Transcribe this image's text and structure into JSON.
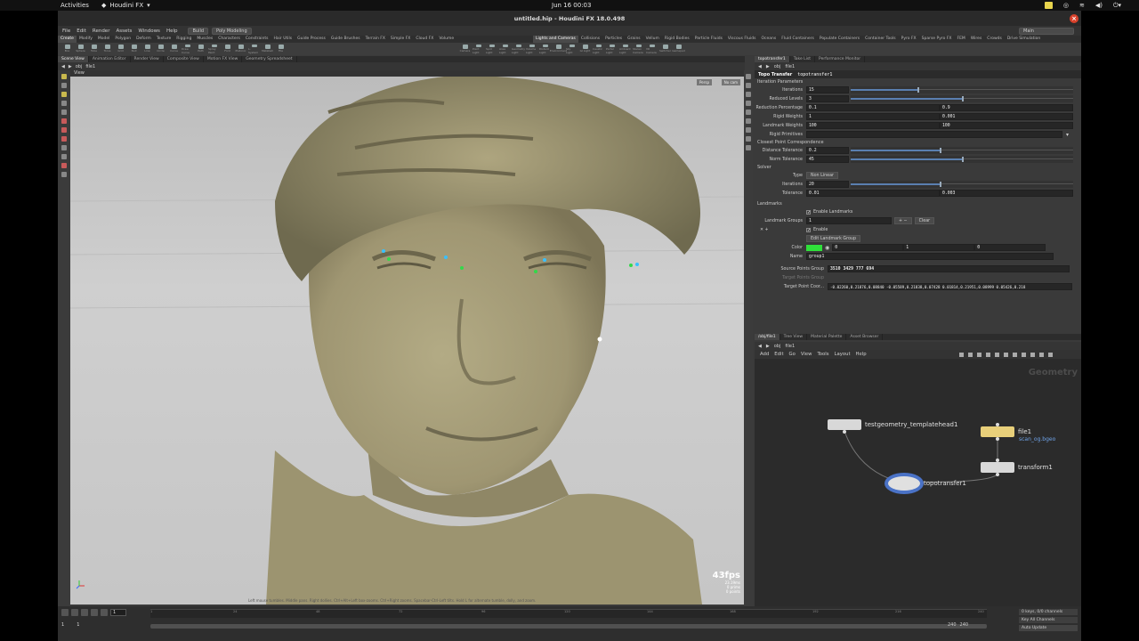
{
  "gnome": {
    "activities": "Activities",
    "app_name": "Houdini FX",
    "clock": "Jun 16  00:03"
  },
  "window": {
    "title": "untitled.hip - Houdini FX 18.0.498"
  },
  "menubar": {
    "items": [
      "File",
      "Edit",
      "Render",
      "Assets",
      "Windows",
      "Help"
    ],
    "desktop": "Build",
    "desktop2": "Poly Modeling",
    "right_desktop": "Main"
  },
  "shelf": {
    "tabs_left": [
      "Create",
      "Modify",
      "Model",
      "Polygon",
      "Deform",
      "Texture",
      "Rigging",
      "Muscles",
      "Characters",
      "Constraints",
      "Hair Utils",
      "Guide Process",
      "Guide Brushes",
      "Terrain FX",
      "Simple FX",
      "Cloud FX",
      "Volume"
    ],
    "tabs_right": [
      "Lights and Cameras",
      "Collisions",
      "Particles",
      "Grains",
      "Vellum",
      "Rigid Bodies",
      "Particle Fluids",
      "Viscous Fluids",
      "Oceans",
      "Fluid Containers",
      "Populate Containers",
      "Container Tools",
      "Pyro FX",
      "Sparse Pyro FX",
      "FEM",
      "Wires",
      "Crowds",
      "Drive Simulation"
    ],
    "tools_left": [
      "Box",
      "Sphere",
      "Tube",
      "Torus",
      "Grid",
      "Null",
      "Line",
      "Circle",
      "Curve",
      "Draw Curve",
      "Path",
      "Spray Paint",
      "Font",
      "Platonic",
      "L-System",
      "Metaball",
      "File"
    ],
    "tools_right": [
      "Camera",
      "Point Light",
      "Spot Light",
      "Area Light",
      "Geometry Light",
      "Volume Light",
      "Distant Light",
      "Environment",
      "Sky Light",
      "GI Light",
      "Caustic Light",
      "Portal Light",
      "Ambient Light",
      "Stereo Camera",
      "VR Camera",
      "Switcher",
      "Gamepad"
    ]
  },
  "viewer_tabs": [
    "Scene View",
    "Animation Editor",
    "Render View",
    "Composite View",
    "Motion FX View",
    "Geometry Spreadsheet"
  ],
  "viewer": {
    "path": [
      "obj",
      "file1"
    ],
    "label": "View",
    "persp": "Persp",
    "cam": "No cam",
    "fps": "43fps",
    "fps_sub": "23.19ms",
    "stats1": "0  prims",
    "stats2": "0  points",
    "hint": "Left mouse tumbles. Middle pans. Right dollies. Ctrl+Alt+Left box-zooms. Ctrl+Right zooms. Spacebar-Ctrl-Left tilts. Hold L for alternate tumble, dolly, and zoom."
  },
  "timeline": {
    "frame": "1",
    "start": "1",
    "start2": "1",
    "end": "240",
    "end2": "240",
    "ticks": [
      "1",
      "24",
      "48",
      "72",
      "96",
      "120",
      "144",
      "168",
      "192",
      "216",
      "240"
    ],
    "keys": "0 keys, 0/0 channels",
    "key_all": "Key All Channels",
    "auto_update": "Auto Update"
  },
  "param_tabs": [
    "topotransfer1",
    "Take List",
    "Performance Monitor"
  ],
  "params": {
    "path": [
      "obj",
      "file1"
    ],
    "node_type": "Topo Transfer",
    "node_name": "topotransfer1",
    "sec_iteration": "Iteration Parameters",
    "iterations_label": "Iterations",
    "iterations": "15",
    "iterations_frac": 0.3,
    "reduced_label": "Reduced Levels",
    "reduced": "3",
    "reduced_frac": 0.5,
    "reduction_label": "Reduction Percentage",
    "reduction_a": "0.1",
    "reduction_b": "0.9",
    "rigid_label": "Rigid Weights",
    "rigid_a": "1",
    "rigid_b": "0.001",
    "landmark_w_label": "Landmark Weights",
    "landmark_w_a": "100",
    "landmark_w_b": "100",
    "rigid_prims_label": "Rigid Primitives",
    "sec_closest": "Closest Point Correspondence",
    "dist_tol_label": "Distance Tolerance",
    "dist_tol": "0.2",
    "dist_tol_frac": 0.4,
    "norm_tol_label": "Norm Tolerance",
    "norm_tol": "45",
    "norm_tol_frac": 0.5,
    "sec_solver": "Solver",
    "type_label": "Type",
    "type_value": "Non Linear",
    "solver_iter_label": "Iterations",
    "solver_iter": "20",
    "solver_iter_frac": 0.4,
    "tolerance_label": "Tolerance",
    "tolerance_a": "0.01",
    "tolerance_b": "0.003",
    "sec_landmarks": "Landmarks",
    "enable_landmarks": "Enable Landmarks",
    "landmark_groups_label": "Landmark Groups",
    "landmark_groups": "1",
    "clear": "Clear",
    "enable": "Enable",
    "edit_group": "Edit Landmark Group",
    "color_label": "Color",
    "color_r": "0",
    "color_g": "1",
    "color_b": "0",
    "landmark_color": "#2fe03a",
    "name_label": "Name",
    "name_value": "group1",
    "source_label": "Source Points Group",
    "source_value": "3510 3429 777 694",
    "target_label": "Target Points Group",
    "target_coord_label": "Target Point Coor...",
    "target_coord_value": "-0.02260,0.21876,0.08840 -0.05589,0.21838,0.07428 0.01814,0.21951,0.08999 0.05426,0.218"
  },
  "net_tabs": [
    "/obj/file1",
    "Tree View",
    "Material Palette",
    "Asset Browser"
  ],
  "network": {
    "path": [
      "obj",
      "file1"
    ],
    "menu": [
      "Add",
      "Edit",
      "Go",
      "View",
      "Tools",
      "Layout",
      "Help"
    ],
    "context": "Geometry",
    "nodes": {
      "template": "testgeometry_templatehead1",
      "file": "file1",
      "file_sub": "scan_og.bgeo",
      "transform": "transform1",
      "topo": "topotransfer1"
    }
  }
}
